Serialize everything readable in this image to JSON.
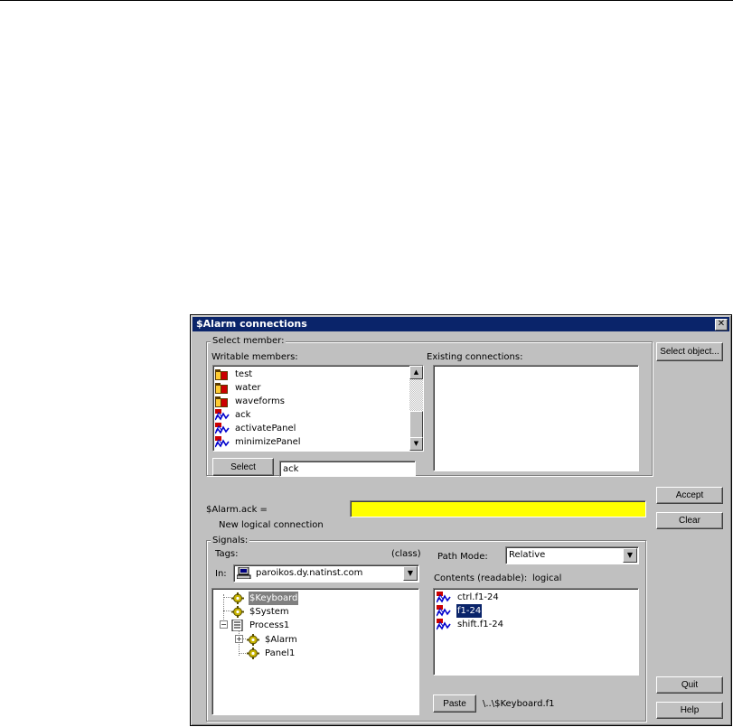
{
  "dialog": {
    "title": "$Alarm connections",
    "close_glyph": "✕"
  },
  "select_member": {
    "group_label": "Select member:",
    "writable_label": "Writable members:",
    "existing_label": "Existing connections:",
    "writable_items": [
      {
        "label": "test",
        "icon": "folder-icon"
      },
      {
        "label": "water",
        "icon": "folder-icon"
      },
      {
        "label": "waveforms",
        "icon": "folder-icon"
      },
      {
        "label": "ack",
        "icon": "signal-icon"
      },
      {
        "label": "activatePanel",
        "icon": "signal-icon"
      },
      {
        "label": "minimizePanel",
        "icon": "signal-icon"
      }
    ],
    "select_button": "Select",
    "select_value": "ack"
  },
  "buttons": {
    "select_object": "Select object...",
    "accept": "Accept",
    "clear": "Clear",
    "quit": "Quit",
    "help": "Help",
    "paste": "Paste"
  },
  "connection": {
    "label": "$Alarm.ack =",
    "status": "New logical connection",
    "value": "",
    "highlight_color": "#ffff00"
  },
  "signals": {
    "group_label": "Signals:",
    "tags_label": "Tags:",
    "class_label": "(class)",
    "in_label": "In:",
    "in_value": "paroikos.dy.natinst.com",
    "path_mode_label": "Path Mode:",
    "path_mode_value": "Relative",
    "contents_label": "Contents (readable):",
    "contents_mode": "logical",
    "tree": [
      {
        "label": "$Keyboard",
        "selected": true
      },
      {
        "label": "$System"
      },
      {
        "label": "Process1"
      },
      {
        "label": "$Alarm"
      },
      {
        "label": "Panel1"
      }
    ],
    "contents": [
      {
        "label": "ctrl.f1-24"
      },
      {
        "label": "f1-24",
        "selected": true
      },
      {
        "label": "shift.f1-24"
      }
    ],
    "paste_path": "\\..\\$Keyboard.f1"
  }
}
